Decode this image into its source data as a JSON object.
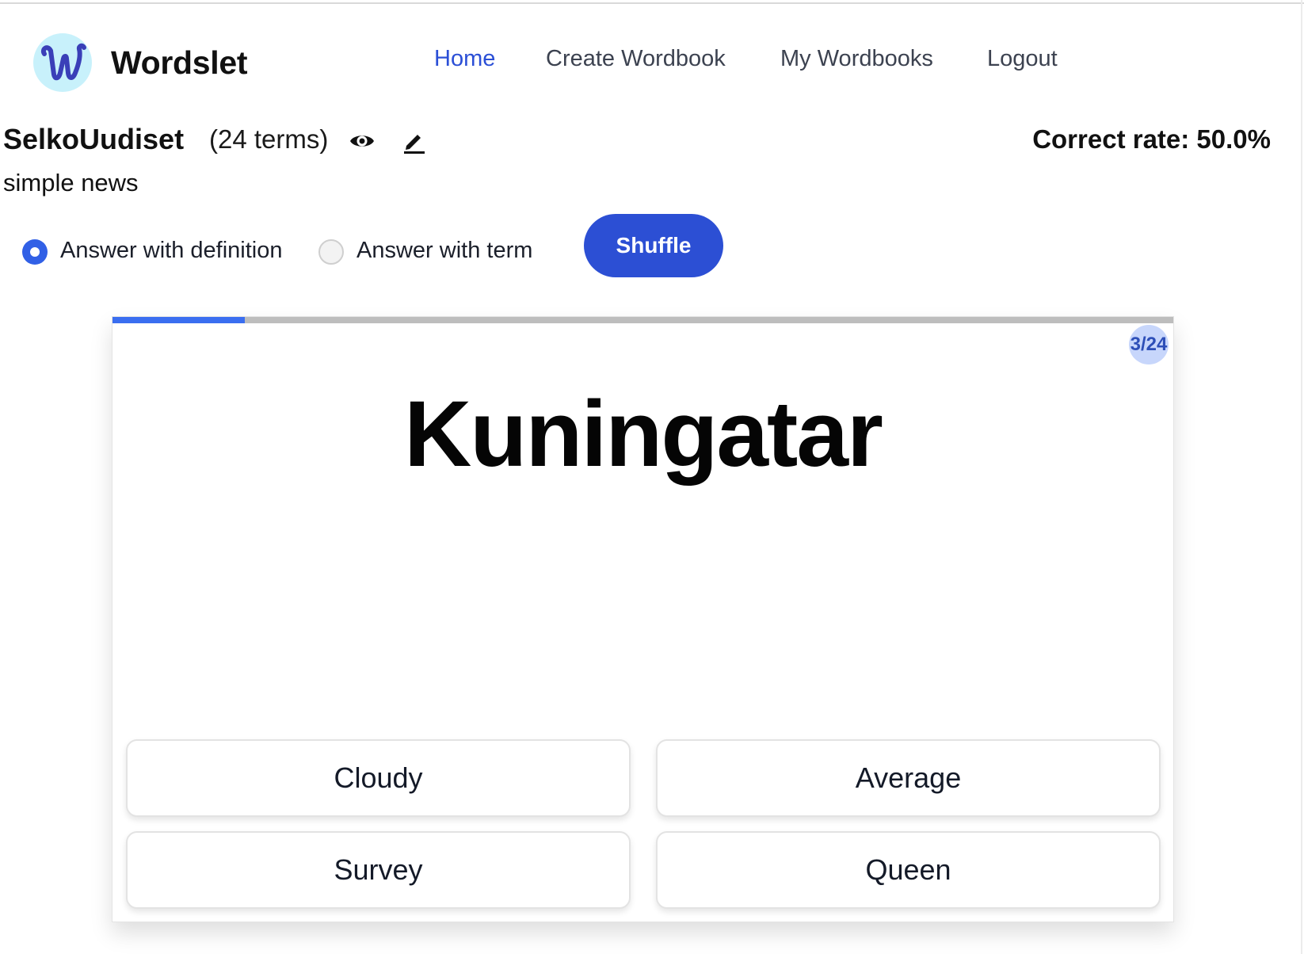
{
  "app": {
    "brand": "Wordslet",
    "logo_letter": "w"
  },
  "nav": {
    "items": [
      {
        "label": "Home",
        "active": true
      },
      {
        "label": "Create Wordbook",
        "active": false
      },
      {
        "label": "My Wordbooks",
        "active": false
      },
      {
        "label": "Logout",
        "active": false
      }
    ]
  },
  "wordbook": {
    "title": "SelkoUudiset",
    "term_count": "(24 terms)",
    "description": "simple news",
    "view_icon": "eye-icon",
    "edit_icon": "pencil-icon"
  },
  "stats": {
    "correct_rate": "Correct rate: 50.0%"
  },
  "mode": {
    "options": [
      {
        "label": "Answer with definition",
        "checked": true
      },
      {
        "label": "Answer with term",
        "checked": false
      }
    ],
    "shuffle_label": "Shuffle"
  },
  "quiz": {
    "progress_fraction": 0.125,
    "counter": "3/24",
    "term": "Kuningatar",
    "choices": [
      "Cloudy",
      "Average",
      "Survey",
      "Queen"
    ]
  },
  "colors": {
    "accent": "#2c4fd4",
    "progress": "#3a6ef0",
    "nav_active": "#2b4fd6",
    "logo_bg": "#c8f1fb"
  }
}
